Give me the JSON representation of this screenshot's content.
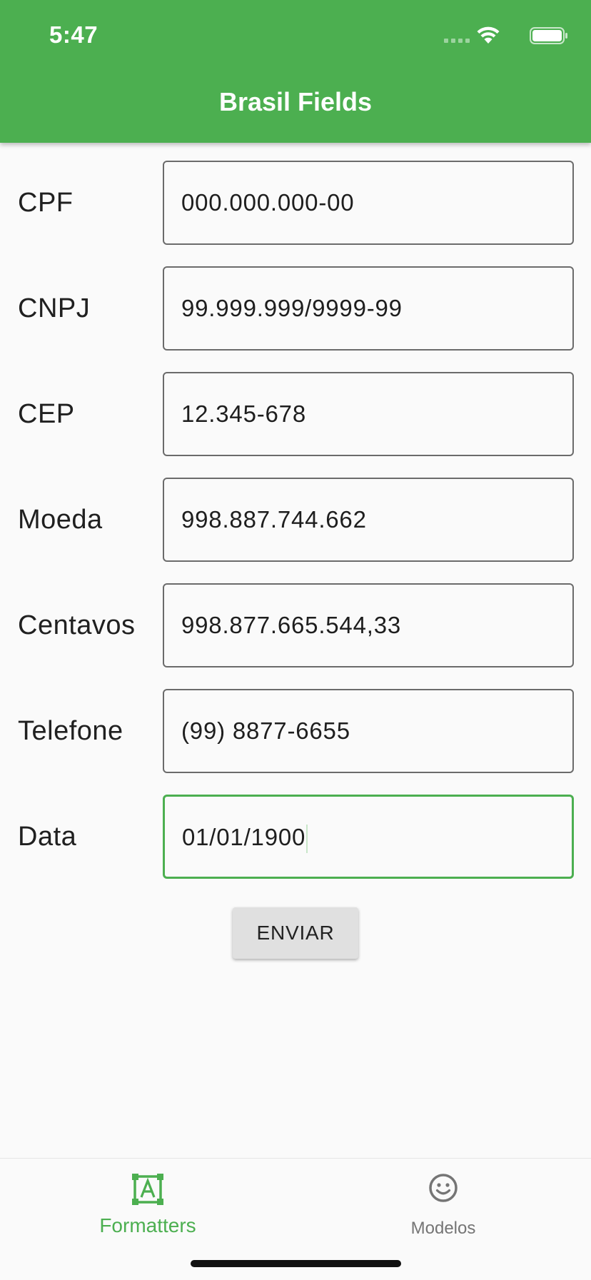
{
  "status_bar": {
    "time": "5:47"
  },
  "app_bar": {
    "title": "Brasil Fields"
  },
  "form": {
    "fields": [
      {
        "label": "CPF",
        "value": "000.000.000-00"
      },
      {
        "label": "CNPJ",
        "value": "99.999.999/9999-99"
      },
      {
        "label": "CEP",
        "value": "12.345-678"
      },
      {
        "label": "Moeda",
        "value": "998.887.744.662"
      },
      {
        "label": "Centavos",
        "value": "998.877.665.544,33"
      },
      {
        "label": "Telefone",
        "value": "(99) 8877-6655"
      },
      {
        "label": "Data",
        "value": "01/01/1900",
        "focused": true
      }
    ],
    "submit_label": "ENVIAR"
  },
  "bottom_nav": {
    "items": [
      {
        "label": "Formatters",
        "icon": "text-format-icon",
        "active": true
      },
      {
        "label": "Modelos",
        "icon": "smiley-face-icon",
        "active": false
      }
    ]
  },
  "colors": {
    "primary": "#4caf50",
    "background": "#fafafa",
    "inactive": "#757575"
  }
}
